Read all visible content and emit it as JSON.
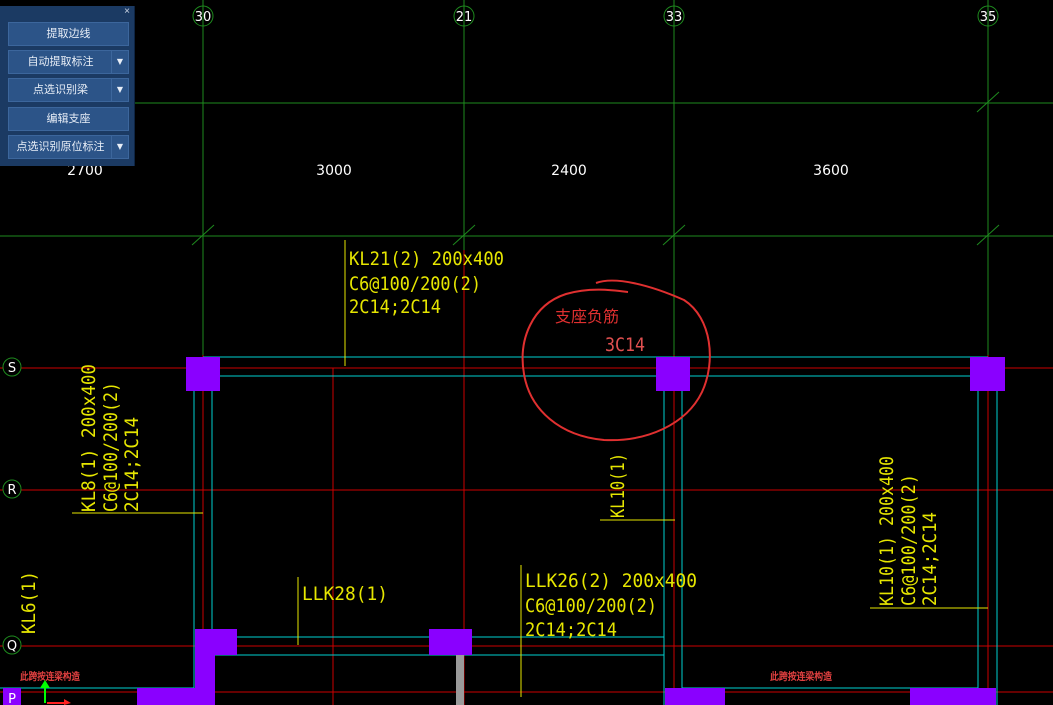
{
  "toolbar": {
    "close_glyph": "×",
    "buttons": [
      {
        "label": "提取边线"
      },
      {
        "label": "自动提取标注"
      },
      {
        "label": "点选识别梁"
      },
      {
        "label": "编辑支座"
      },
      {
        "label": "点选识别原位标注"
      }
    ],
    "dropdown_glyph": "▼"
  },
  "drawing": {
    "column_axes": [
      "30",
      "21",
      "33",
      "35"
    ],
    "row_axes": [
      "S",
      "R",
      "Q",
      "P"
    ],
    "spans": [
      "2700",
      "3000",
      "2400",
      "3600"
    ],
    "beams": {
      "kl21": [
        "KL21(2) 200x400",
        "C6@100/200(2)",
        "2C14;2C14"
      ],
      "kl8": [
        "KL8(1) 200x400",
        "C6@100/200(2)",
        "2C14;2C14"
      ],
      "kl10_mid": "KL10(1)",
      "kl10_right": [
        "KL10(1) 200x400",
        "C6@100/200(2)",
        "2C14;2C14"
      ],
      "llk28": "LLK28(1)",
      "llk26": [
        "LLK26(2) 200x400",
        "C6@100/200(2)",
        "2C14;2C14"
      ],
      "kl6": "KL6(1)"
    },
    "annotation": {
      "title": "支座负筋",
      "value": "3C14"
    },
    "notes": {
      "left": "此跨按连梁构造",
      "right": "此跨按连梁构造"
    },
    "colors": {
      "column": "#8a00ff",
      "beam_line": "#00d0d0",
      "axis_line": "#cc0000",
      "grid_green": "#1e8a1e",
      "text_yellow": "#e6e600",
      "annotation_red": "#e03030"
    }
  }
}
